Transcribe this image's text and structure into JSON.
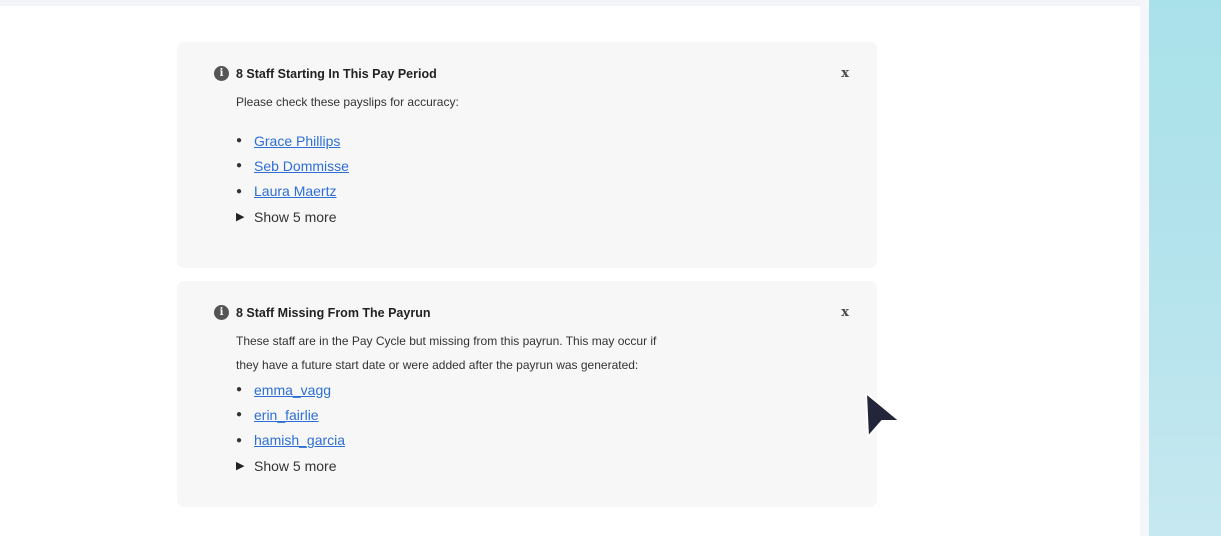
{
  "notices": [
    {
      "icon": "info-icon",
      "icon_glyph": "i",
      "title": "8 Staff Starting In This Pay Period",
      "description": "Please check these payslips for accuracy:",
      "close_label": "x",
      "staff": [
        "Grace Phillips",
        "Seb Dommisse",
        "Laura Maertz"
      ],
      "show_more": "Show 5 more"
    },
    {
      "icon": "info-icon",
      "icon_glyph": "i",
      "title": "8 Staff Missing From The Payrun",
      "description_line1": "These staff are in the Pay Cycle but missing from this payrun. This may occur if",
      "description_line2": "they have a future start date or were added after the payrun was generated:",
      "close_label": "x",
      "staff": [
        "emma_vagg",
        "erin_fairlie",
        "hamish_garcia"
      ],
      "show_more": "Show 5 more"
    }
  ],
  "colors": {
    "link": "#2d6fd6",
    "card_bg": "#f7f7f7",
    "side_panel": "#a9e1ea",
    "cursor": "#23263a"
  }
}
